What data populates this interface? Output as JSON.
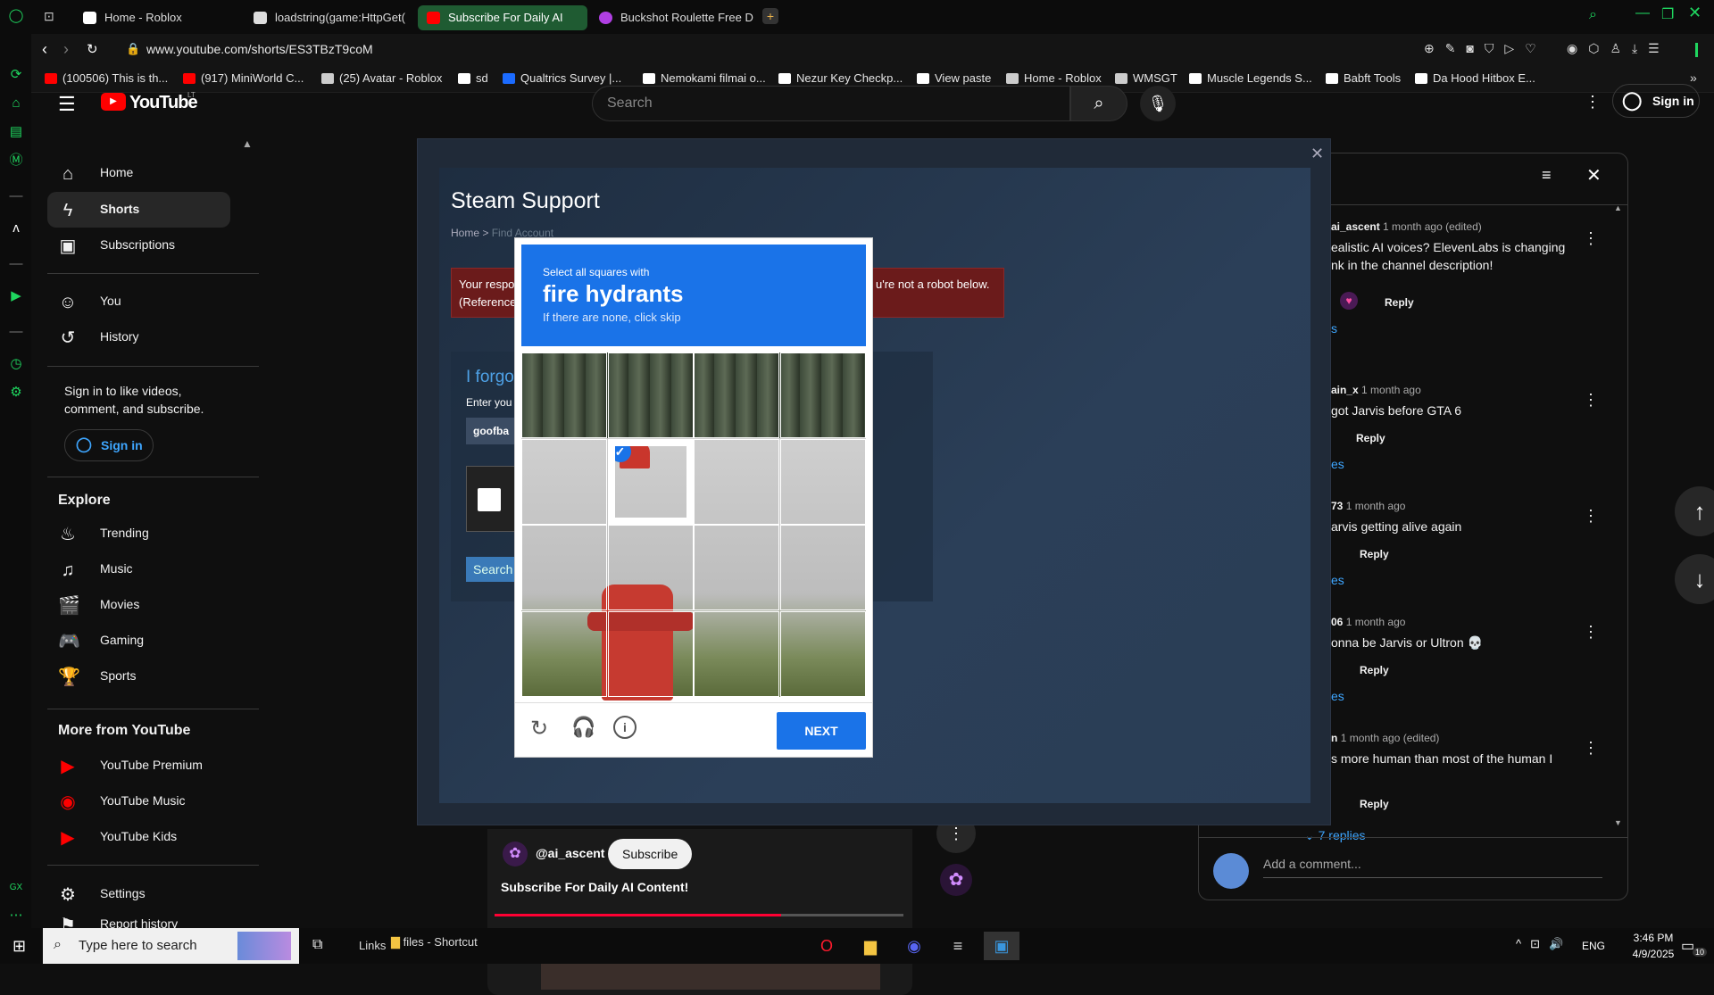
{
  "browser": {
    "tabs": [
      {
        "title": "Home - Roblox",
        "color": "#ffffff"
      },
      {
        "title": "loadstring(game:HttpGet(",
        "color": "#ffffff"
      },
      {
        "title": "Subscribe For Daily AI",
        "color": "#ff0000"
      },
      {
        "title": "Buckshot Roulette Free D",
        "color": "#b03fe3"
      }
    ],
    "url": "www.youtube.com/shorts/ES3TBzT9coM",
    "bookmarks": [
      {
        "label": "(100506) This is th...",
        "color": "#ff0000"
      },
      {
        "label": "(917) MiniWorld C...",
        "color": "#ff0000"
      },
      {
        "label": "(25) Avatar - Roblox",
        "color": "#cccccc"
      },
      {
        "label": "sd",
        "color": "#ffffff"
      },
      {
        "label": "Qualtrics Survey |...",
        "color": "#1b6bff"
      },
      {
        "label": "Nemokami filmai o...",
        "color": "#ffffff"
      },
      {
        "label": "Nezur Key Checkp...",
        "color": "#ffffff"
      },
      {
        "label": "View paste",
        "color": "#ffffff"
      },
      {
        "label": "Home - Roblox",
        "color": "#cccccc"
      },
      {
        "label": "WMSGT",
        "color": "#cccccc"
      },
      {
        "label": "Muscle Legends S...",
        "color": "#ffffff"
      },
      {
        "label": "Babft Tools",
        "color": "#ffffff"
      },
      {
        "label": "Da Hood Hitbox E...",
        "color": "#ffffff"
      }
    ]
  },
  "youtube": {
    "logo_text": "YouTube",
    "country": "LT",
    "search_placeholder": "Search",
    "sign_in": "Sign in",
    "sidebar": {
      "main": [
        "Home",
        "Shorts",
        "Subscriptions"
      ],
      "you": [
        "You",
        "History"
      ],
      "signin_prompt": "Sign in to like videos, comment, and subscribe.",
      "signin_button": "Sign in",
      "explore_title": "Explore",
      "explore": [
        "Trending",
        "Music",
        "Movies",
        "Gaming",
        "Sports"
      ],
      "more_title": "More from YouTube",
      "more": [
        "YouTube Premium",
        "YouTube Music",
        "YouTube Kids"
      ],
      "settings": [
        "Settings",
        "Report history"
      ]
    },
    "short": {
      "channel": "@ai_ascent",
      "subscribe": "Subscribe",
      "title": "Subscribe For Daily AI Content!",
      "progress": 0.7
    },
    "comments": [
      {
        "user": "ai_ascent",
        "time": "1 month ago (edited)",
        "text": "ealistic AI voices? ElevenLabs is changing\nnk in the channel description!",
        "reply": "Reply",
        "replies": "s"
      },
      {
        "user": "ain_x",
        "time": "1 month ago",
        "text": "got Jarvis before GTA 6",
        "reply": "Reply",
        "replies": "es"
      },
      {
        "user": "73",
        "time": "1 month ago",
        "text": "arvis getting alive again",
        "reply": "Reply",
        "replies": "es"
      },
      {
        "user": "06",
        "time": "1 month ago",
        "text": "onna be Jarvis or Ultron 💀",
        "reply": "Reply",
        "replies": "es"
      },
      {
        "user": "n",
        "time": "1 month ago (edited)",
        "text": "s more human than most of the human I",
        "reply": "Reply",
        "replies": "7 replies"
      }
    ],
    "add_comment": "Add a comment..."
  },
  "steam": {
    "title": "Steam Support",
    "breadcrumb_home": "Home",
    "breadcrumb_sep": ">",
    "breadcrumb_page": "Find Account",
    "error_line1": "Your respo",
    "error_line1_end": "u're not a robot below.",
    "error_line2": "(Reference",
    "forgot": "I forgo",
    "enter": "Enter you",
    "input_value": "goofba",
    "search_btn": "Search"
  },
  "captcha": {
    "instruction": "Select all squares with",
    "target": "fire hydrants",
    "hint": "If there are none, click skip",
    "next": "NEXT",
    "grid": [
      [
        0,
        0,
        0,
        0
      ],
      [
        0,
        1,
        0,
        0
      ],
      [
        0,
        0,
        0,
        0
      ],
      [
        0,
        0,
        0,
        0
      ]
    ]
  },
  "taskbar": {
    "search": "Type here to search",
    "links": "Links",
    "files": "files - Shortcut",
    "lang": "ENG",
    "time": "3:46 PM",
    "date": "4/9/2025",
    "notif": "10"
  }
}
